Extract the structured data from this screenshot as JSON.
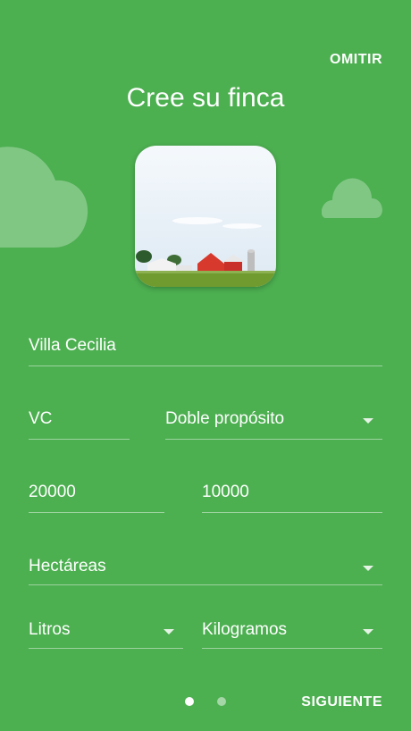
{
  "header": {
    "skip_label": "OMITIR",
    "title": "Cree su finca"
  },
  "form": {
    "farm_name": "Villa Cecilia",
    "initials": "VC",
    "purpose": "Doble propósito",
    "value_1": "20000",
    "value_2": "10000",
    "area_unit": "Hectáreas",
    "volume_unit": "Litros",
    "weight_unit": "Kilogramos"
  },
  "footer": {
    "next_label": "SIGUIENTE",
    "pages": 2,
    "current_page": 1
  },
  "colors": {
    "background": "#4caf50",
    "cloud": "#81c784",
    "dot_active": "#ffffff",
    "dot_inactive": "#a5d6a7"
  },
  "icons": [
    "cloud-icon",
    "farm-image",
    "dropdown-arrow-icon"
  ]
}
